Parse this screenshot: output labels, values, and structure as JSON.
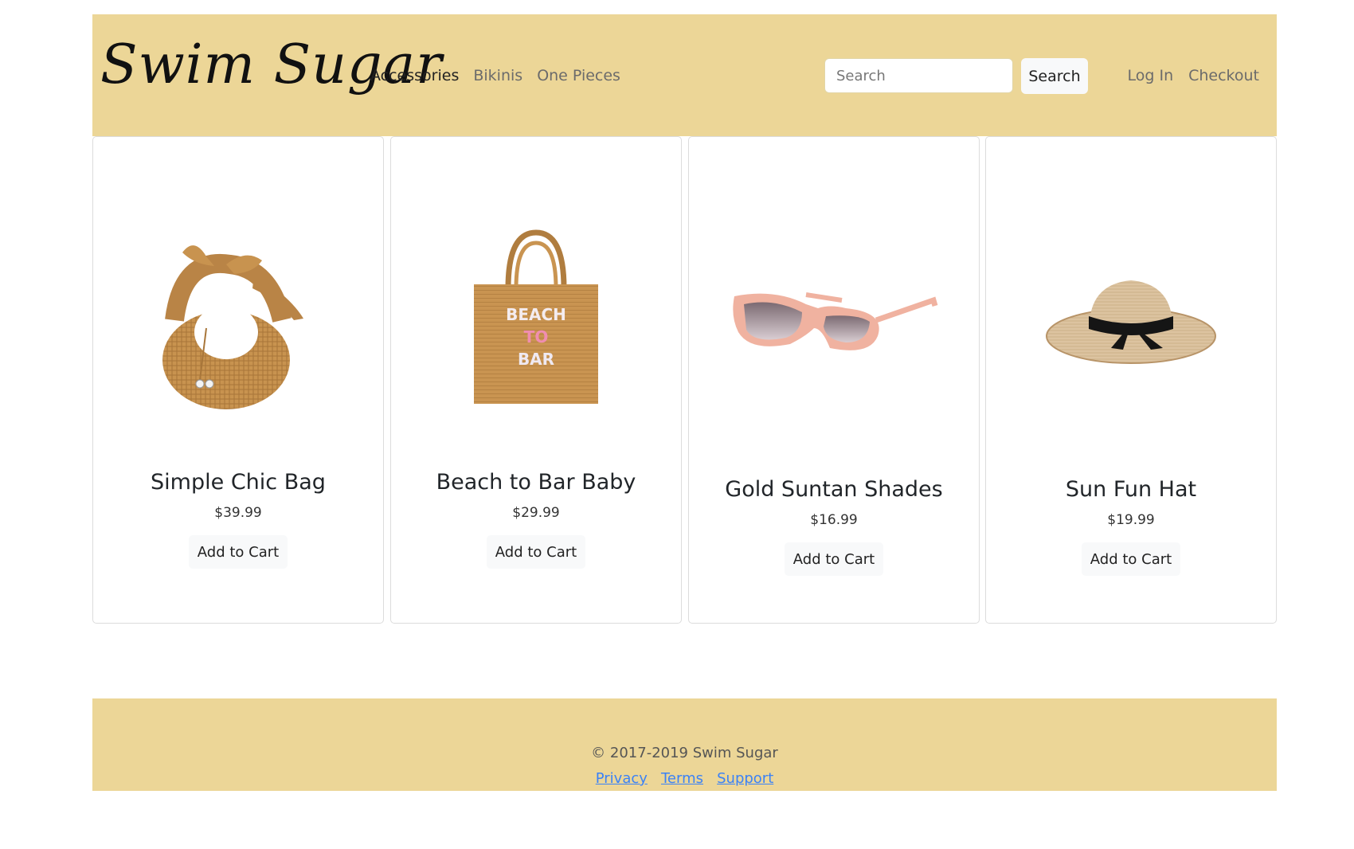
{
  "brand": {
    "logo": "Swim Sugar"
  },
  "nav": {
    "items": [
      {
        "label": "Accessories",
        "active": true
      },
      {
        "label": "Bikinis",
        "active": false
      },
      {
        "label": "One Pieces",
        "active": false
      }
    ]
  },
  "search": {
    "placeholder": "Search",
    "button_label": "Search"
  },
  "account": {
    "login_label": "Log In",
    "checkout_label": "Checkout"
  },
  "products": [
    {
      "name": "Simple Chic Bag",
      "price": "$39.99",
      "button_label": "Add to Cart",
      "image": "woven-knot-bag"
    },
    {
      "name": "Beach to Bar Baby",
      "price": "$29.99",
      "button_label": "Add to Cart",
      "image": "beach-tote-bag",
      "image_text": [
        "BEACH",
        "TO",
        "BAR"
      ]
    },
    {
      "name": "Gold Suntan Shades",
      "price": "$16.99",
      "button_label": "Add to Cart",
      "image": "pink-sunglasses"
    },
    {
      "name": "Sun Fun Hat",
      "price": "$19.99",
      "button_label": "Add to Cart",
      "image": "straw-sun-hat"
    }
  ],
  "footer": {
    "copyright": "© 2017-2019 Swim Sugar",
    "links": [
      "Privacy",
      "Terms",
      "Support"
    ]
  },
  "colors": {
    "header_bg": "#ecd697",
    "link_blue": "#3b82f6"
  }
}
